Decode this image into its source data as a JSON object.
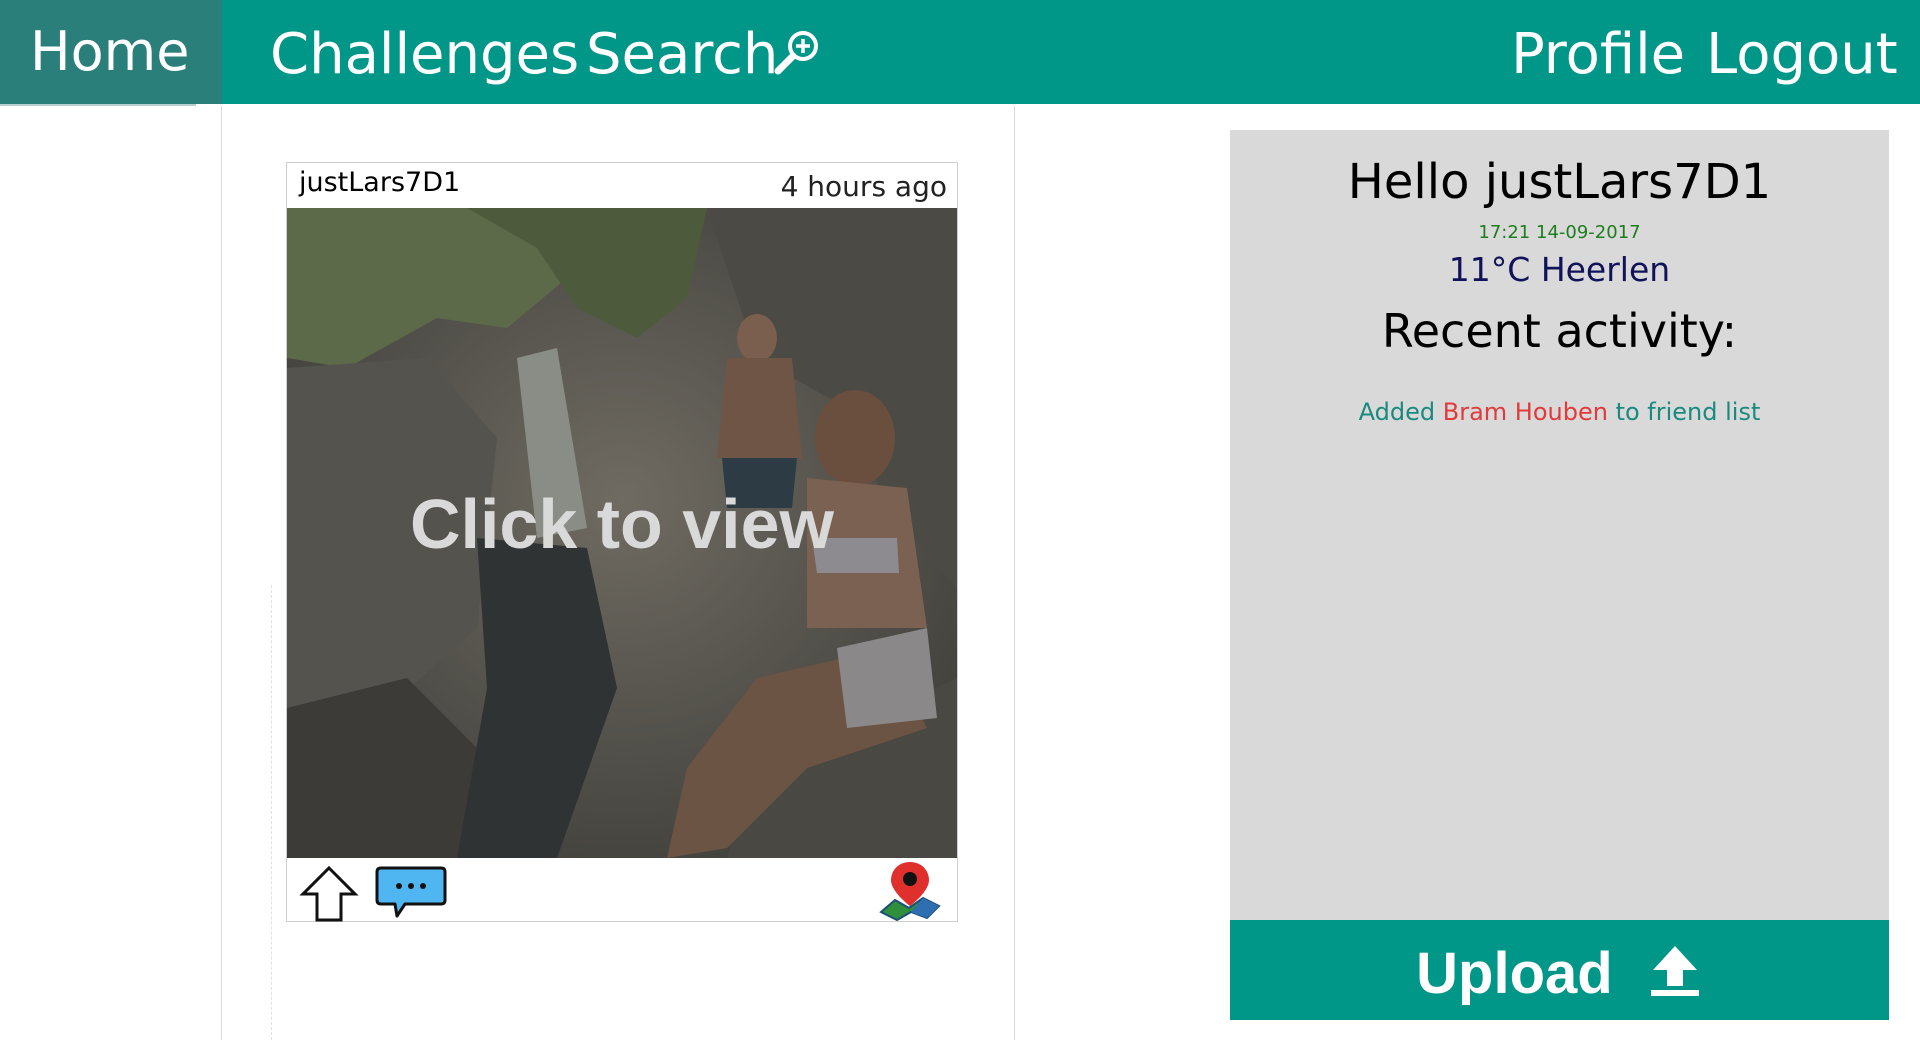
{
  "nav": {
    "home": "Home",
    "challenges": "Challenges",
    "search": "Search",
    "profile": "Profile",
    "logout": "Logout"
  },
  "post": {
    "username": "justLars7D1",
    "time": "4 hours ago",
    "overlay": "Click to view"
  },
  "panel": {
    "greeting": "Hello justLars7D1",
    "datetime": "17:21 14-09-2017",
    "weather": "11°C Heerlen",
    "recent_title": "Recent activity:",
    "activity": {
      "prefix": "Added",
      "friend": "Bram Houben",
      "suffix": "to friend list"
    }
  },
  "upload": {
    "label": "Upload"
  },
  "colors": {
    "accent": "#009688",
    "home_active": "#2a7f7a",
    "panel_bg": "#d9d9d9",
    "datetime": "#1e7d1e",
    "weather": "#12125a",
    "activity_text": "#1b8a7e",
    "activity_friend": "#e03a3a"
  },
  "icons": {
    "search": "magnifier-plus-icon",
    "upvote": "arrow-up-outline-icon",
    "comment": "speech-bubble-icon",
    "location": "map-pin-icon",
    "upload": "upload-arrow-icon"
  }
}
